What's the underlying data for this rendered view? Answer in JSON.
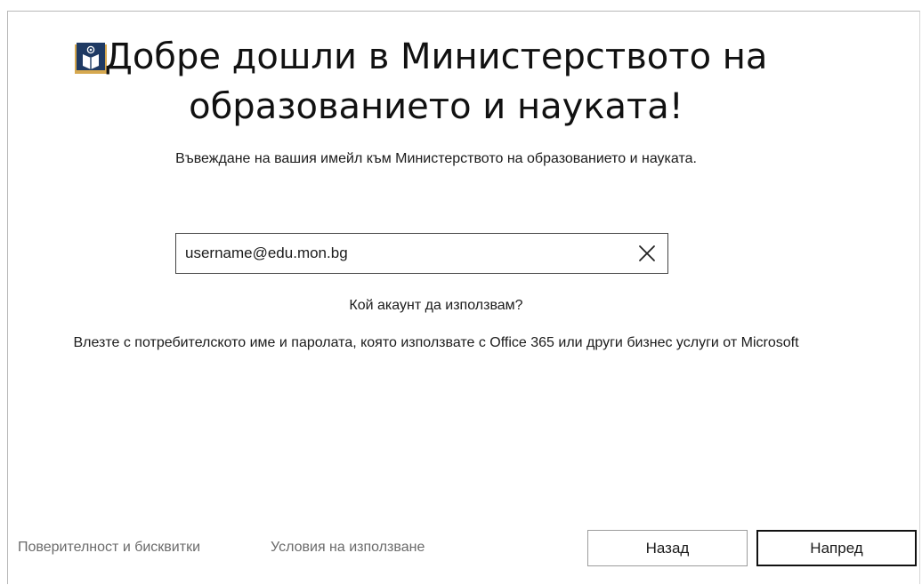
{
  "header": {
    "title": "Добре дошли в Министерството на образованието и науката!",
    "logo_icon": "ministry-logo-icon"
  },
  "subtitle": "Въвеждане на вашия имейл към Министерството на образованието и науката.",
  "email": {
    "value": "username@edu.mon.bg",
    "clear_icon": "close-icon"
  },
  "which_account_link": "Кой акаунт да използвам?",
  "hint": "Влезте с потребителското име и паролата, която използвате с Office 365 или други бизнес услуги от Microsoft",
  "footer": {
    "privacy_link": "Поверителност и бисквитки",
    "terms_link": "Условия на използване",
    "back_label": "Назад",
    "next_label": "Напред"
  },
  "colors": {
    "logo_navy": "#1f3a63",
    "logo_gold": "#d6a84f",
    "footer_link": "#6b6b6b"
  }
}
